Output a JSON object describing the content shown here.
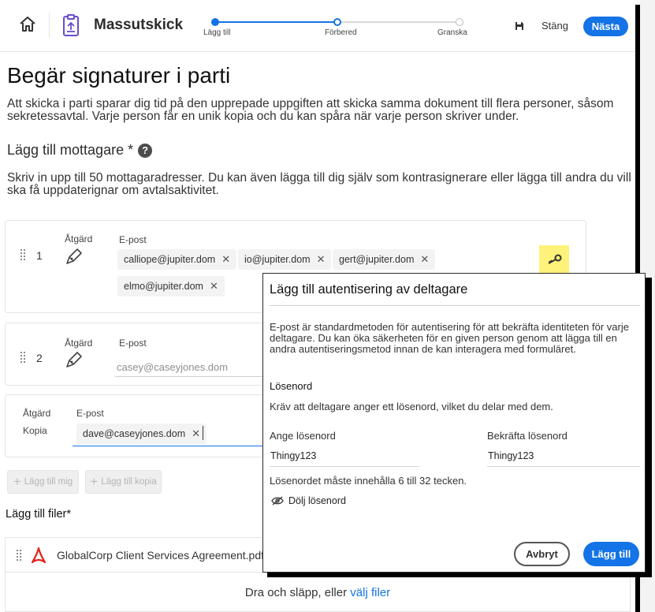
{
  "header": {
    "app_title": "Massutskick",
    "steps": [
      "Lägg till",
      "Förbered",
      "Granska"
    ],
    "close_label": "Stäng",
    "next_label": "Nästa"
  },
  "main": {
    "title": "Begär signaturer i parti",
    "intro": "Att skicka i parti sparar dig tid på den upprepade uppgiften att skicka samma dokument till flera personer, såsom sekretessavtal. Varje person får en unik kopia och du kan spåra när varje person skriver under.",
    "recipients_title": "Lägg till mottagare *",
    "recipients_desc": "Skriv in upp till 50 mottagaradresser. Du kan även lägga till dig själv som kontrasignerare eller lägga till andra du vill ska få uppdaterignar om avtalsaktivitet."
  },
  "recipients": [
    {
      "number": "1",
      "action_label": "Åtgärd",
      "email_label": "E-post",
      "emails": [
        "calliope@jupiter.dom",
        "io@jupiter.dom",
        "gert@jupiter.dom",
        "elmo@jupiter.dom"
      ]
    },
    {
      "number": "2",
      "action_label": "Åtgärd",
      "email_label": "E-post",
      "placeholder": "casey@caseyjones.dom"
    }
  ],
  "cc": {
    "action_label": "Åtgärd",
    "action_value": "Kopia",
    "email_label": "E-post",
    "emails": [
      "dave@caseyjones.dom"
    ]
  },
  "buttons": {
    "add_me": "Lägg till mig",
    "add_cc": "Lägg till kopia"
  },
  "files": {
    "title": "Lägg till filer*",
    "file_name": "GlobalCorp Client Services Agreement.pdf",
    "drop_text": "Dra och släpp, eller ",
    "drop_link": "välj filer"
  },
  "dialog": {
    "title": "Lägg till autentisering av deltagare",
    "description": "E-post är standardmetoden för autentisering för att bekräfta identiteten för varje deltagare. Du kan öka säkerheten för en given person genom att lägga till en andra autentiseringsmetod innan de kan interagera med formuläret.",
    "subtitle": "Lösenord",
    "note": "Kräv att deltagare anger ett lösenord, vilket du delar med dem.",
    "password_label": "Ange lösenord",
    "password_value": "Thingy123",
    "confirm_label": "Bekräfta lösenord",
    "confirm_value": "Thingy123",
    "hint": "Lösenordet måste innehålla 6 till 32 tecken.",
    "hide_label": "Dölj lösenord",
    "cancel_label": "Avbryt",
    "add_label": "Lägg till"
  },
  "colors": {
    "accent": "#1473e6",
    "highlight": "#fff27a",
    "pdf_icon": "#e0241b"
  }
}
